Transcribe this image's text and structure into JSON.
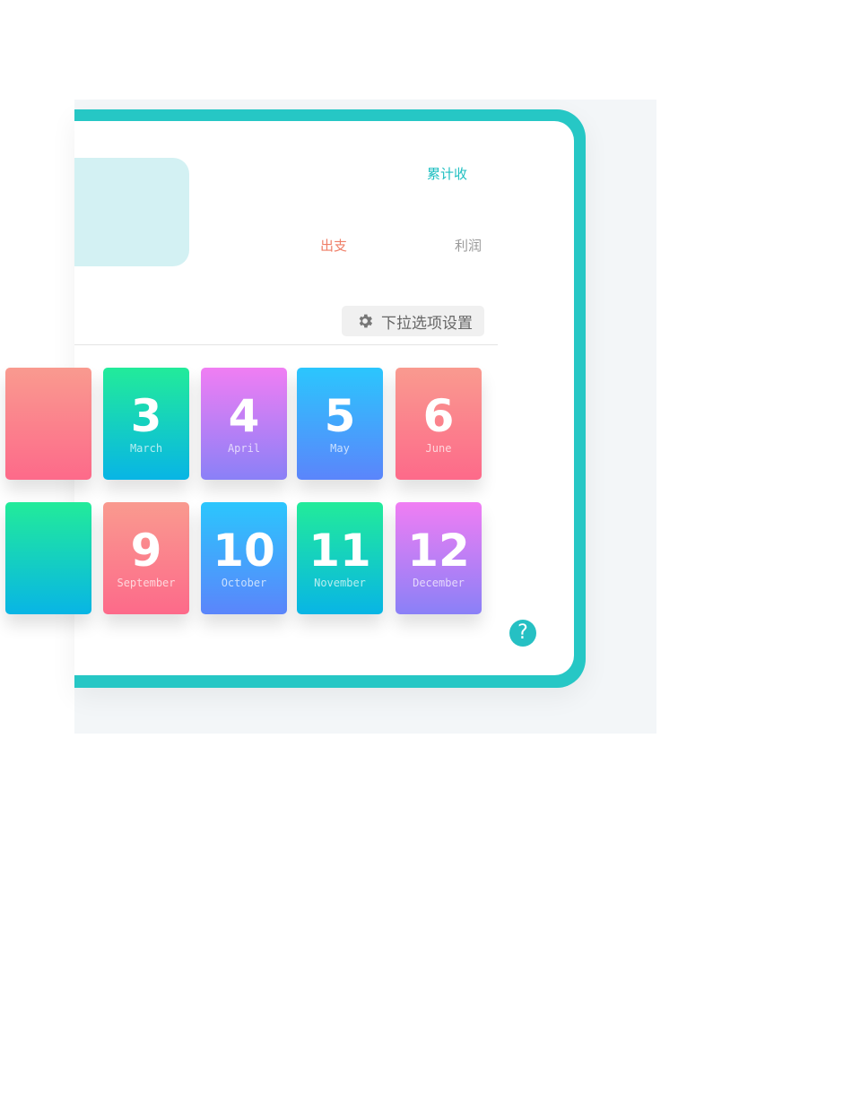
{
  "summary": {
    "income_label": "累计收",
    "expense_label": "出支",
    "profit_label": "利润"
  },
  "toolbar": {
    "settings_label": "下拉选项设置",
    "settings_icon": "gear-icon"
  },
  "help": {
    "icon": "question-icon",
    "glyph": "?"
  },
  "colors": {
    "frame": "#26c7c5",
    "income": "#1fbfc1",
    "expense": "#ef7f68",
    "profit": "#999999"
  },
  "months": [
    {
      "number": "",
      "name": "",
      "gradient": [
        "#f99a8f",
        "#fd6a8a"
      ]
    },
    {
      "number": "3",
      "name": "March",
      "gradient": [
        "#22eb9a",
        "#08b5e5"
      ]
    },
    {
      "number": "4",
      "name": "April",
      "gradient": [
        "#f07ef3",
        "#8a80f7"
      ]
    },
    {
      "number": "5",
      "name": "May",
      "gradient": [
        "#2bc6fd",
        "#5b85fb"
      ]
    },
    {
      "number": "6",
      "name": "June",
      "gradient": [
        "#f99a8f",
        "#fd6a8a"
      ]
    },
    {
      "number": "",
      "name": "",
      "gradient": [
        "#22eb9a",
        "#08b5e5"
      ]
    },
    {
      "number": "9",
      "name": "September",
      "gradient": [
        "#f99a8f",
        "#fd6a8a"
      ]
    },
    {
      "number": "10",
      "name": "October",
      "gradient": [
        "#2bc6fd",
        "#5b85fb"
      ]
    },
    {
      "number": "11",
      "name": "November",
      "gradient": [
        "#22eb9a",
        "#08b5e5"
      ]
    },
    {
      "number": "12",
      "name": "December",
      "gradient": [
        "#f07ef3",
        "#8a80f7"
      ]
    }
  ]
}
